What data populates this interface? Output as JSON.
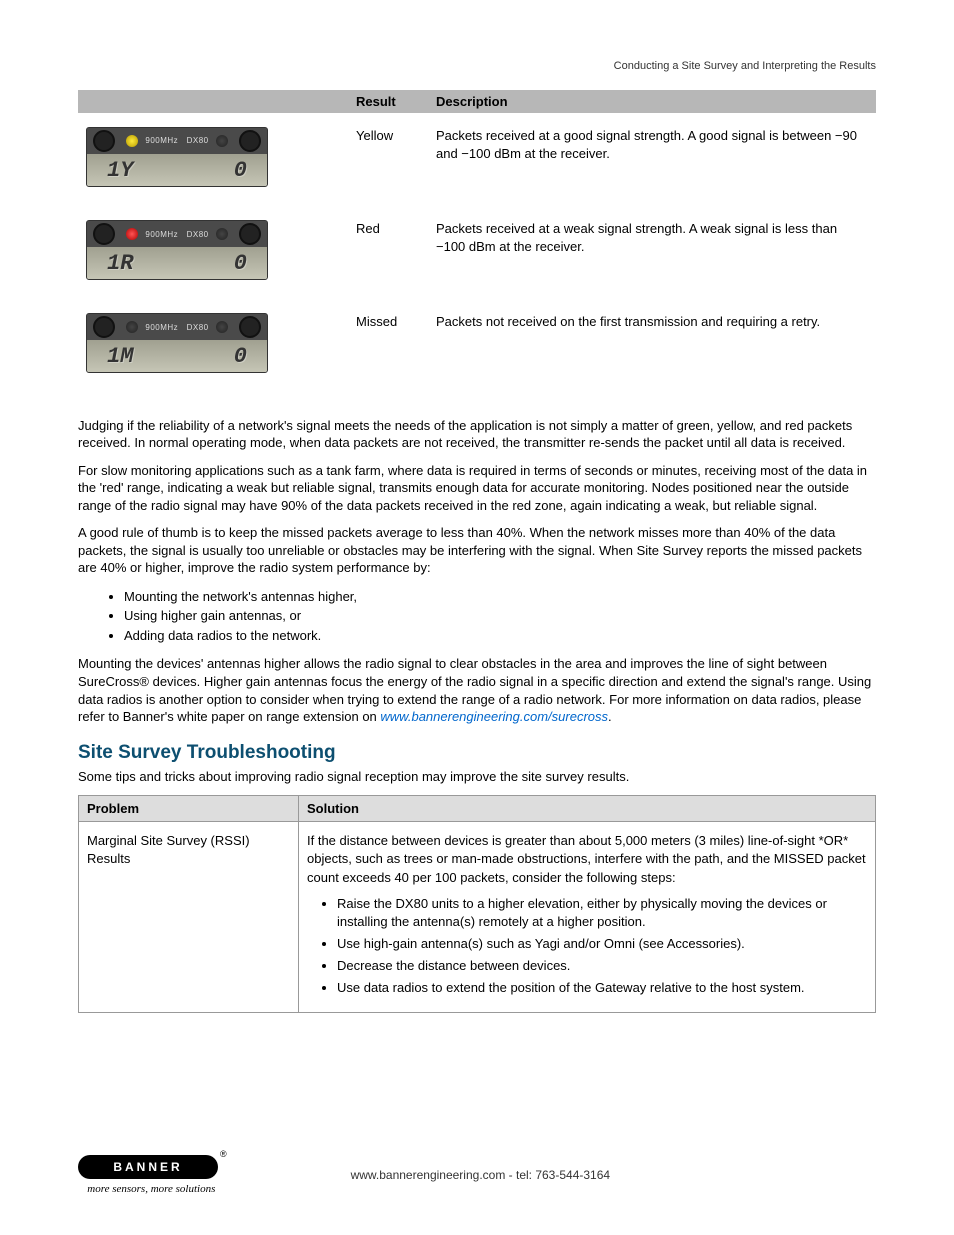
{
  "header": {
    "title": "Conducting a Site Survey and Interpreting the Results"
  },
  "results_table": {
    "head": {
      "c1": "",
      "c2": "Result",
      "c3": "Description"
    },
    "rows": [
      {
        "lcd_left": "1Y",
        "lcd_right": "0",
        "led": "yellow",
        "result": "Yellow",
        "desc": "Packets received at a good signal strength. A good signal is between −90 and −100 dBm at the receiver."
      },
      {
        "lcd_left": "1R",
        "lcd_right": "0",
        "led": "red",
        "result": "Red",
        "desc": "Packets received at a weak signal strength. A weak signal is less than −100 dBm at the receiver."
      },
      {
        "lcd_left": "1M",
        "lcd_right": "0",
        "led": "off",
        "result": "Missed",
        "desc": "Packets not received on the first transmission and requiring a retry."
      }
    ],
    "device_labels": {
      "left": "900MHz",
      "right": "DX80"
    }
  },
  "paragraphs": {
    "p1": "Judging if the reliability of a network's signal meets the needs of the application is not simply a matter of green, yellow, and red packets received. In normal operating mode, when data packets are not received, the transmitter re-sends the packet until all data is received.",
    "p2": "For slow monitoring applications such as a tank farm, where data is required in terms of seconds or minutes, receiving most of the data in the 'red' range, indicating a weak but reliable signal, transmits enough data for accurate monitoring. Nodes positioned near the outside range of the radio signal may have 90% of the data packets received in the red zone, again indicating a weak, but reliable signal.",
    "p3": "A good rule of thumb is to keep the missed packets average to less than 40%. When the network misses more than 40% of the data packets, the signal is usually too unreliable or obstacles may be interfering with the signal. When Site Survey reports the missed packets are 40% or higher, improve the radio system performance by:",
    "bullets1": [
      "Mounting the network's antennas higher,",
      "Using higher gain antennas, or",
      "Adding data radios to the network."
    ],
    "p4_a": "Mounting the devices' antennas higher allows the radio signal to clear obstacles in the area and improves the line of sight between SureCross® devices. Higher gain antennas focus the energy of the radio signal in a specific direction and extend the signal's range. Using data radios is another option to consider when trying to extend the range of a radio network. For more information on data radios, please refer to Banner's white paper on range extension on ",
    "p4_link": "www.bannerengineering.com/surecross",
    "p4_b": "."
  },
  "troubleshoot": {
    "heading": "Site Survey Troubleshooting",
    "intro": "Some tips and tricks about improving radio signal reception may improve the site survey results.",
    "head": {
      "c1": "Problem",
      "c2": "Solution"
    },
    "rows": [
      {
        "problem": "Marginal Site Survey (RSSI) Results",
        "solution_intro": "If the distance between devices is greater than about 5,000 meters (3 miles) line-of-sight *OR* objects, such as trees or man-made obstructions, interfere with the path, and the MISSED packet count exceeds 40 per 100 packets, consider the following steps:",
        "solution_bullets": [
          "Raise the DX80 units to a higher elevation, either by physically moving the devices or installing the antenna(s) remotely at a higher position.",
          "Use high-gain antenna(s) such as Yagi and/or Omni (see Accessories).",
          "Decrease the distance between devices.",
          "Use data radios to extend the position of the Gateway relative to the host system."
        ]
      }
    ]
  },
  "footer": {
    "logo_text": "BANNER",
    "tagline": "more sensors, more solutions",
    "text": "www.bannerengineering.com - tel: 763-544-3164"
  }
}
